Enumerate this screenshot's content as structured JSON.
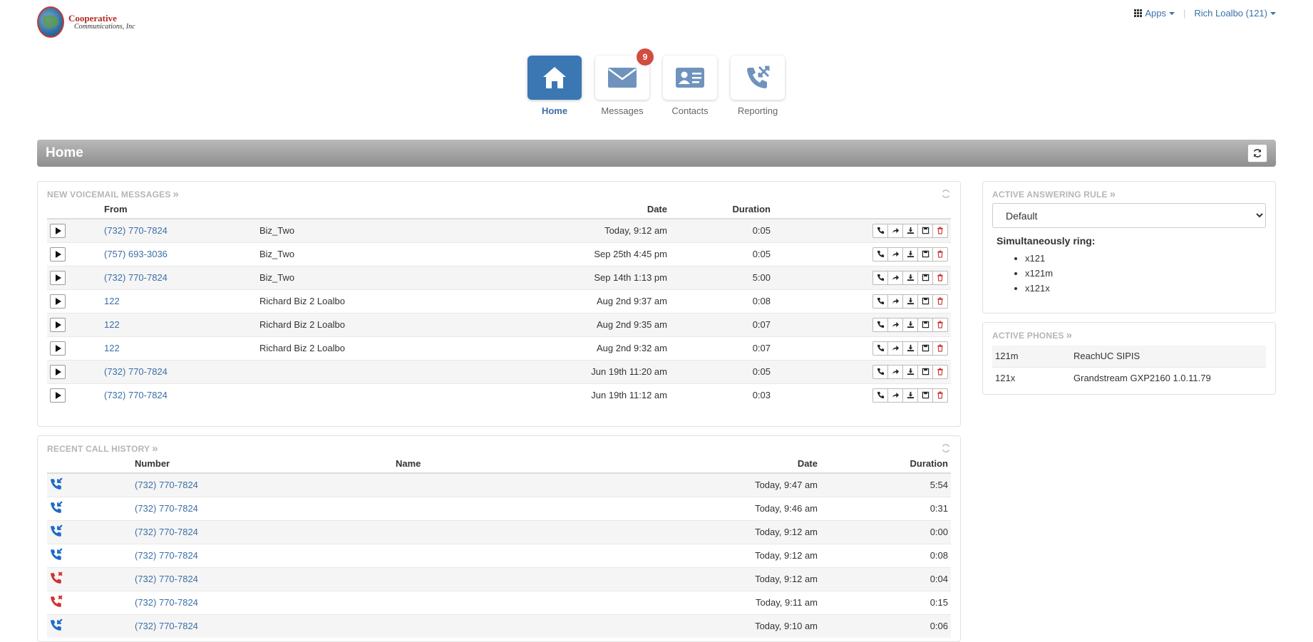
{
  "branding": {
    "line1": "Cooperative",
    "line2": "Communications, Inc"
  },
  "topbar": {
    "apps_label": "Apps",
    "user_label": "Rich Loalbo (121)"
  },
  "nav": [
    {
      "label": "Home",
      "icon": "home-icon",
      "active": true
    },
    {
      "label": "Messages",
      "icon": "envelope-icon",
      "badge": "9"
    },
    {
      "label": "Contacts",
      "icon": "contact-card-icon"
    },
    {
      "label": "Reporting",
      "icon": "phone-reporting-icon"
    }
  ],
  "page": {
    "title": "Home"
  },
  "voicemail": {
    "title": "New Voicemail Messages",
    "headers": {
      "from": "From",
      "date": "Date",
      "duration": "Duration"
    },
    "rows": [
      {
        "from": "(732) 770-7824",
        "name": "Biz_Two",
        "date": "Today, 9:12 am",
        "duration": "0:05"
      },
      {
        "from": "(757) 693-3036",
        "name": "Biz_Two",
        "date": "Sep 25th 4:45 pm",
        "duration": "0:05"
      },
      {
        "from": "(732) 770-7824",
        "name": "Biz_Two",
        "date": "Sep 14th 1:13 pm",
        "duration": "5:00"
      },
      {
        "from": "122",
        "name": "Richard Biz 2 Loalbo",
        "date": "Aug 2nd 9:37 am",
        "duration": "0:08"
      },
      {
        "from": "122",
        "name": "Richard Biz 2 Loalbo",
        "date": "Aug 2nd 9:35 am",
        "duration": "0:07"
      },
      {
        "from": "122",
        "name": "Richard Biz 2 Loalbo",
        "date": "Aug 2nd 9:32 am",
        "duration": "0:07"
      },
      {
        "from": "(732) 770-7824",
        "name": "",
        "date": "Jun 19th 11:20 am",
        "duration": "0:05"
      },
      {
        "from": "(732) 770-7824",
        "name": "",
        "date": "Jun 19th 11:12 am",
        "duration": "0:03"
      }
    ]
  },
  "calls": {
    "title": "Recent Call History",
    "headers": {
      "number": "Number",
      "name": "Name",
      "date": "Date",
      "duration": "Duration"
    },
    "rows": [
      {
        "type": "received",
        "number": "(732) 770-7824",
        "name": "",
        "date": "Today, 9:47 am",
        "duration": "5:54"
      },
      {
        "type": "received",
        "number": "(732) 770-7824",
        "name": "",
        "date": "Today, 9:46 am",
        "duration": "0:31"
      },
      {
        "type": "received",
        "number": "(732) 770-7824",
        "name": "",
        "date": "Today, 9:12 am",
        "duration": "0:00"
      },
      {
        "type": "received",
        "number": "(732) 770-7824",
        "name": "",
        "date": "Today, 9:12 am",
        "duration": "0:08"
      },
      {
        "type": "missed",
        "number": "(732) 770-7824",
        "name": "",
        "date": "Today, 9:12 am",
        "duration": "0:04"
      },
      {
        "type": "missed",
        "number": "(732) 770-7824",
        "name": "",
        "date": "Today, 9:11 am",
        "duration": "0:15"
      },
      {
        "type": "received",
        "number": "(732) 770-7824",
        "name": "",
        "date": "Today, 9:10 am",
        "duration": "0:06"
      }
    ]
  },
  "answering_rule": {
    "title": "Active Answering Rule",
    "selected": "Default",
    "sim_ring_label": "Simultaneously ring:",
    "ring_list": [
      "x121",
      "x121m",
      "x121x"
    ]
  },
  "phones": {
    "title": "Active Phones",
    "rows": [
      {
        "ext": "121m",
        "model": "ReachUC SIPIS"
      },
      {
        "ext": "121x",
        "model": "Grandstream GXP2160 1.0.11.79"
      }
    ]
  },
  "colors": {
    "accent": "#3b77b3",
    "link": "#3a6fa6",
    "badge": "#d24c41",
    "missed": "#d32f2f",
    "received": "#1e6ac8"
  }
}
